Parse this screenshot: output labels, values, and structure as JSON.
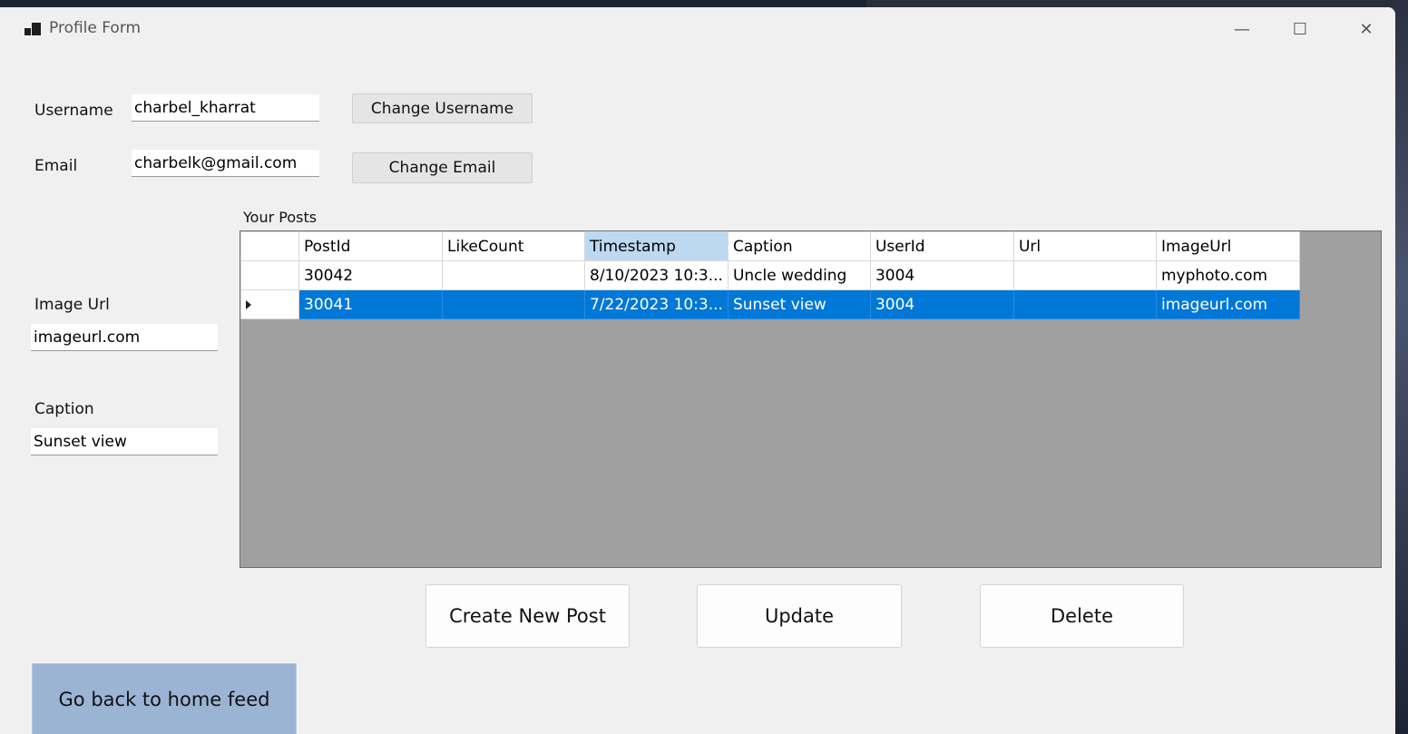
{
  "window": {
    "title": "Profile Form",
    "minimize": "—",
    "maximize": "☐",
    "close": "✕"
  },
  "profile": {
    "username_label": "Username",
    "username_value": "charbel_kharrat",
    "change_username_label": "Change Username",
    "email_label": "Email",
    "email_value": "charbelk@gmail.com",
    "change_email_label": "Change Email"
  },
  "post_form": {
    "image_url_label": "Image Url",
    "image_url_value": "imageurl.com",
    "caption_label": "Caption",
    "caption_value": "Sunset view"
  },
  "posts": {
    "title": "Your Posts",
    "columns": [
      "PostId",
      "LikeCount",
      "Timestamp",
      "Caption",
      "UserId",
      "Url",
      "ImageUrl"
    ],
    "sorted_column": "Timestamp",
    "rows": [
      {
        "PostId": "30042",
        "LikeCount": "",
        "Timestamp": "8/10/2023 10:3...",
        "Caption": "Uncle wedding",
        "UserId": "3004",
        "Url": "",
        "ImageUrl": "myphoto.com",
        "selected": false
      },
      {
        "PostId": "30041",
        "LikeCount": "",
        "Timestamp": "7/22/2023 10:3...",
        "Caption": "Sunset view",
        "UserId": "3004",
        "Url": "",
        "ImageUrl": "imageurl.com",
        "selected": true
      }
    ]
  },
  "actions": {
    "create_label": "Create New Post",
    "update_label": "Update",
    "delete_label": "Delete",
    "home_label": "Go back to home feed"
  },
  "colors": {
    "selection": "#0078d7",
    "sorted_header": "#bcd9f1",
    "grid_background": "#a0a0a0",
    "home_button": "#9cb4d4"
  }
}
